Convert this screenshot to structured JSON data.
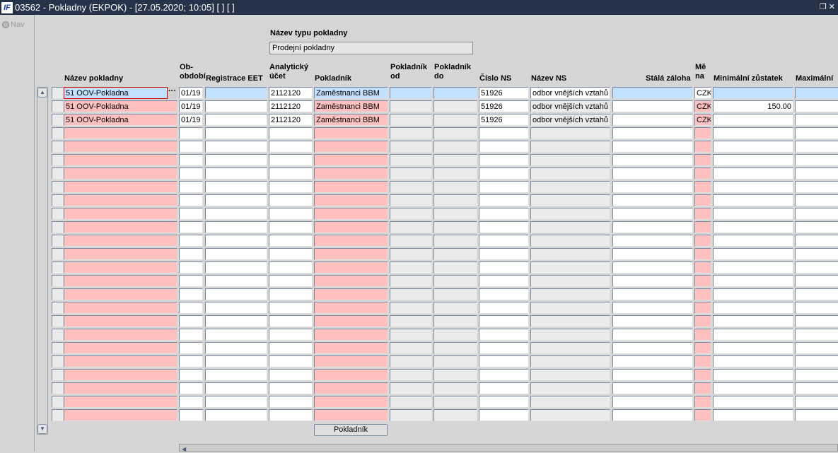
{
  "window": {
    "title": "03562 - Pokladny (EKPOK) - [27.05.2020; 10:05]  [ ]  [ ]",
    "logo": "IF"
  },
  "nav": {
    "label": "Nav"
  },
  "type": {
    "label": "Název typu pokladny",
    "value": "Prodejní pokladny"
  },
  "columns": [
    {
      "key": "sel",
      "label": ""
    },
    {
      "key": "nazev",
      "label": "Název pokladny"
    },
    {
      "key": "obdobi",
      "label": "Ob-\nobdobí"
    },
    {
      "key": "eet",
      "label": "Registrace EET"
    },
    {
      "key": "ucet",
      "label": "Analytický\núčet"
    },
    {
      "key": "pokladnik",
      "label": "Pokladník"
    },
    {
      "key": "od",
      "label": "Pokladník\nod"
    },
    {
      "key": "do",
      "label": "Pokladník\ndo"
    },
    {
      "key": "cislo_ns",
      "label": "Číslo NS"
    },
    {
      "key": "nazev_ns",
      "label": "Název NS"
    },
    {
      "key": "zaloha",
      "label": "Stálá záloha"
    },
    {
      "key": "mena",
      "label": "Mě\nna"
    },
    {
      "key": "min",
      "label": "Minimální zůstatek"
    },
    {
      "key": "max",
      "label": "Maximální"
    }
  ],
  "rows": [
    {
      "nazev": "51 OOV-Pokladna",
      "obdobi": "01/19",
      "ucet": "2112120",
      "pokladnik": "Zaměstnanci BBM",
      "cislo_ns": "51926",
      "nazev_ns": "odbor vnějších vztahů",
      "mena": "CZK",
      "min": ""
    },
    {
      "nazev": "51 OOV-Pokladna",
      "obdobi": "01/19",
      "ucet": "2112120",
      "pokladnik": "Zaměstnanci BBM",
      "cislo_ns": "51926",
      "nazev_ns": "odbor vnějších vztahů",
      "mena": "CZK",
      "min": "150.00"
    },
    {
      "nazev": "51 OOV-Pokladna",
      "obdobi": "01/19",
      "ucet": "2112120",
      "pokladnik": "Zaměstnanci BBM",
      "cislo_ns": "51926",
      "nazev_ns": "odbor vnějších vztahů",
      "mena": "CZK",
      "min": ""
    }
  ],
  "selected_row": 0,
  "buttons": {
    "pokladnik": "Pokladník",
    "lov": "···"
  },
  "colors": {
    "required": "#ffc0c0",
    "readonly": "#ebebeb",
    "selected": "#c2e0ff",
    "titlebar": "#253249"
  }
}
